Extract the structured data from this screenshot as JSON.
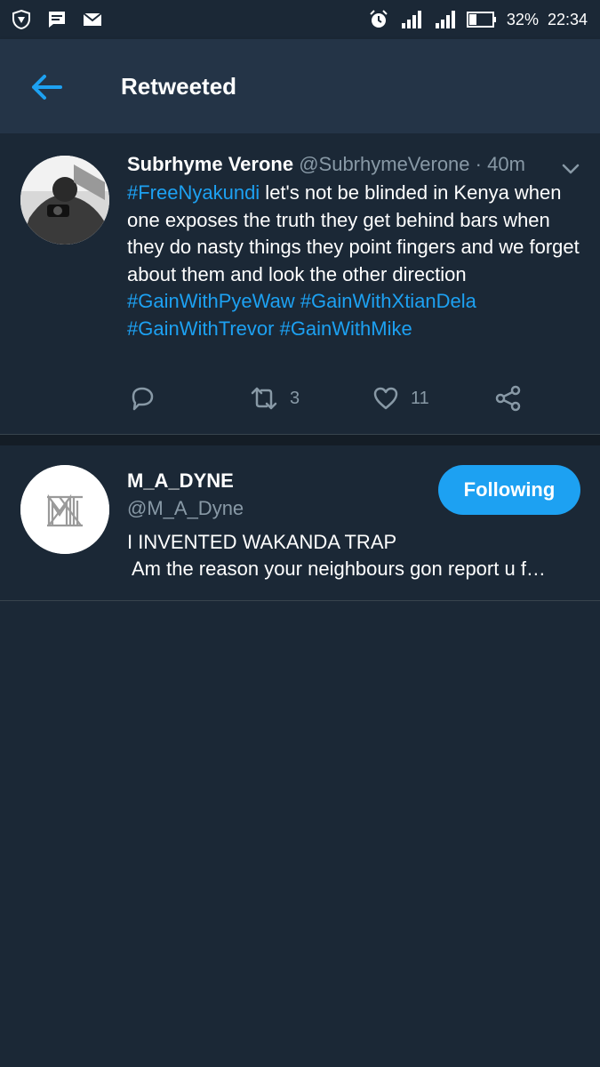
{
  "status_bar": {
    "battery": "32%",
    "time": "22:34"
  },
  "app_bar": {
    "title": "Retweeted"
  },
  "tweet": {
    "name": "Subrhyme Verone",
    "handle": "@SubrhymeVerone",
    "separator": "·",
    "time": "40m",
    "body": [
      {
        "text": "#FreeNyakundi",
        "hashtag": true
      },
      {
        "text": " let's not be blinded in Kenya when one exposes the truth they get behind bars when they do nasty things they point fingers and we forget about them and look the other direction ",
        "hashtag": false
      },
      {
        "text": "#GainWithPyeWaw",
        "hashtag": true
      },
      {
        "text": " ",
        "hashtag": false
      },
      {
        "text": "#GainWithXtianDela",
        "hashtag": true
      },
      {
        "text": " ",
        "hashtag": false
      },
      {
        "text": "#GainWithTrevor",
        "hashtag": true
      },
      {
        "text": " ",
        "hashtag": false
      },
      {
        "text": "#GainWithMike",
        "hashtag": true
      }
    ],
    "retweet_count": "3",
    "like_count": "11"
  },
  "user_card": {
    "name": "M_A_DYNE",
    "handle": "@M_A_Dyne",
    "bio_line1": "I INVENTED WAKANDA TRAP",
    "bio_line2": "Am the reason your neighbours gon report u f…",
    "follow_label": "Following"
  },
  "colors": {
    "background": "#1b2836",
    "app_bar": "#243447",
    "accent": "#1da1f2",
    "secondary_text": "#8899a6"
  }
}
